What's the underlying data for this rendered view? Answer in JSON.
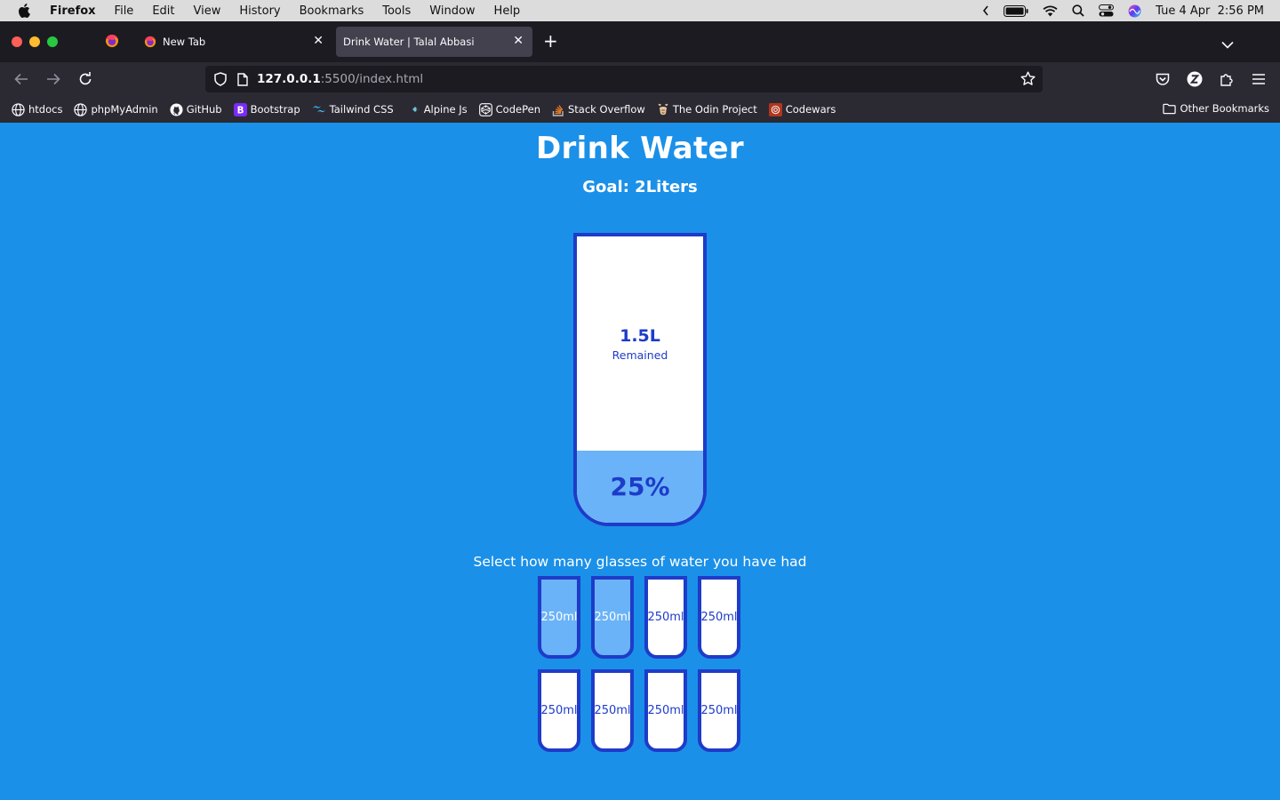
{
  "menubar": {
    "app_name": "Firefox",
    "items": [
      "File",
      "Edit",
      "View",
      "History",
      "Bookmarks",
      "Tools",
      "Window",
      "Help"
    ],
    "datetime": "Tue 4 Apr  2:56 PM"
  },
  "tabs": [
    {
      "title": "New Tab",
      "active": false
    },
    {
      "title": "Drink Water | Talal Abbasi",
      "active": true
    }
  ],
  "urlbar": {
    "host": "127.0.0.1",
    "path": ":5500/index.html"
  },
  "bookmarks": [
    {
      "label": "htdocs",
      "icon": "globe-icon"
    },
    {
      "label": "phpMyAdmin",
      "icon": "globe-icon"
    },
    {
      "label": "GitHub",
      "icon": "github-icon"
    },
    {
      "label": "Bootstrap",
      "icon": "bootstrap-icon"
    },
    {
      "label": "Tailwind CSS",
      "icon": "tailwind-icon"
    },
    {
      "label": "Alpine Js",
      "icon": "alpine-icon"
    },
    {
      "label": "CodePen",
      "icon": "codepen-icon"
    },
    {
      "label": "Stack Overflow",
      "icon": "stackoverflow-icon"
    },
    {
      "label": "The Odin Project",
      "icon": "odin-icon"
    },
    {
      "label": "Codewars",
      "icon": "codewars-icon"
    }
  ],
  "other_bookmarks": "Other Bookmarks",
  "app": {
    "title": "Drink Water",
    "goal": "Goal: 2Liters",
    "remained_value": "1.5L",
    "remained_label": "Remained",
    "percentage": "25%",
    "fill_fraction": 0.25,
    "select_text": "Select how many glasses of water you have had",
    "cups": [
      {
        "label": "250ml",
        "full": true
      },
      {
        "label": "250ml",
        "full": true
      },
      {
        "label": "250ml",
        "full": false
      },
      {
        "label": "250ml",
        "full": false
      },
      {
        "label": "250ml",
        "full": false
      },
      {
        "label": "250ml",
        "full": false
      },
      {
        "label": "250ml",
        "full": false
      },
      {
        "label": "250ml",
        "full": false
      }
    ]
  },
  "colors": {
    "page_bg": "#1b90e8",
    "cup_border": "#1e3bc9",
    "fill": "#6ab3f8"
  }
}
